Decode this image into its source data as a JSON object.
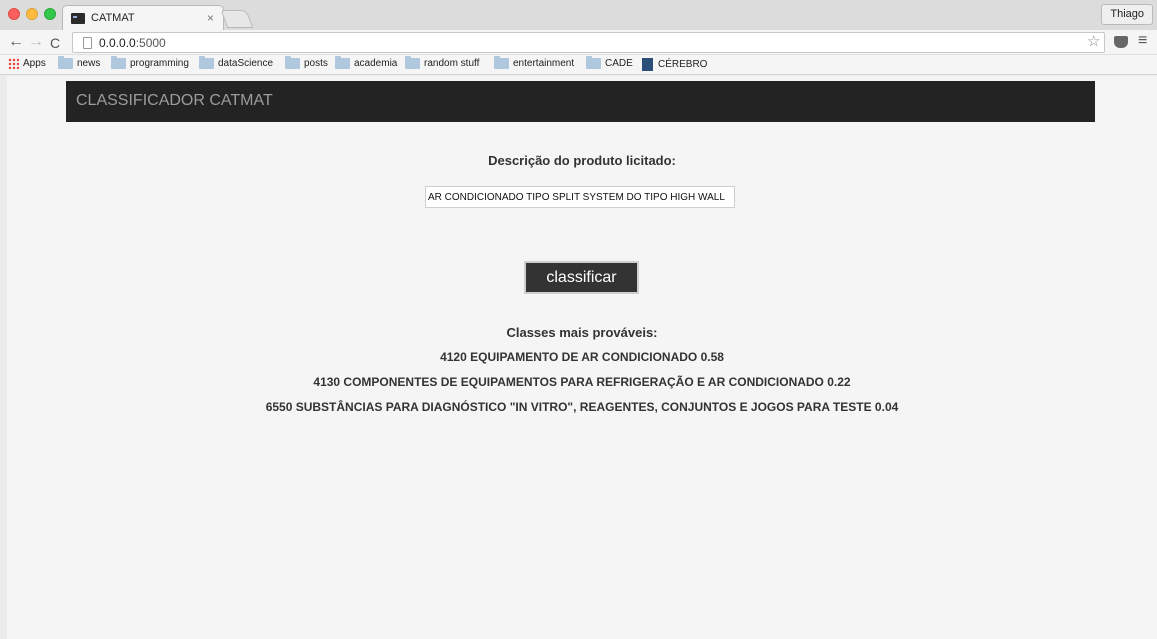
{
  "browser": {
    "tab_title": "CATMAT",
    "tab_close": "×",
    "profile_name": "Thiago",
    "url_host": "0.0.0.0",
    "url_port": ":5000",
    "nav": {
      "back": "←",
      "forward": "→",
      "reload": "C",
      "star": "☆",
      "menu": "≡"
    },
    "bookmarks": [
      "Apps",
      "news",
      "programming",
      "dataScience",
      "posts",
      "academia",
      "random stuff",
      "entertainment",
      "CADE",
      "CÉREBRO"
    ]
  },
  "app": {
    "title": "CLASSIFICADOR CATMAT",
    "input_label": "Descrição do produto licitado:",
    "input_value": "AR CONDICIONADO TIPO SPLIT SYSTEM DO TIPO HIGH WALL",
    "button_label": "classificar",
    "results_title": "Classes mais prováveis:",
    "results": [
      "4120 EQUIPAMENTO DE AR CONDICIONADO 0.58",
      "4130 COMPONENTES DE EQUIPAMENTOS PARA REFRIGERAÇÃO E AR CONDICIONADO 0.22",
      "6550 SUBSTÂNCIAS PARA DIAGNÓSTICO \"IN VITRO\", REAGENTES, CONJUNTOS E JOGOS PARA TESTE 0.04"
    ]
  }
}
